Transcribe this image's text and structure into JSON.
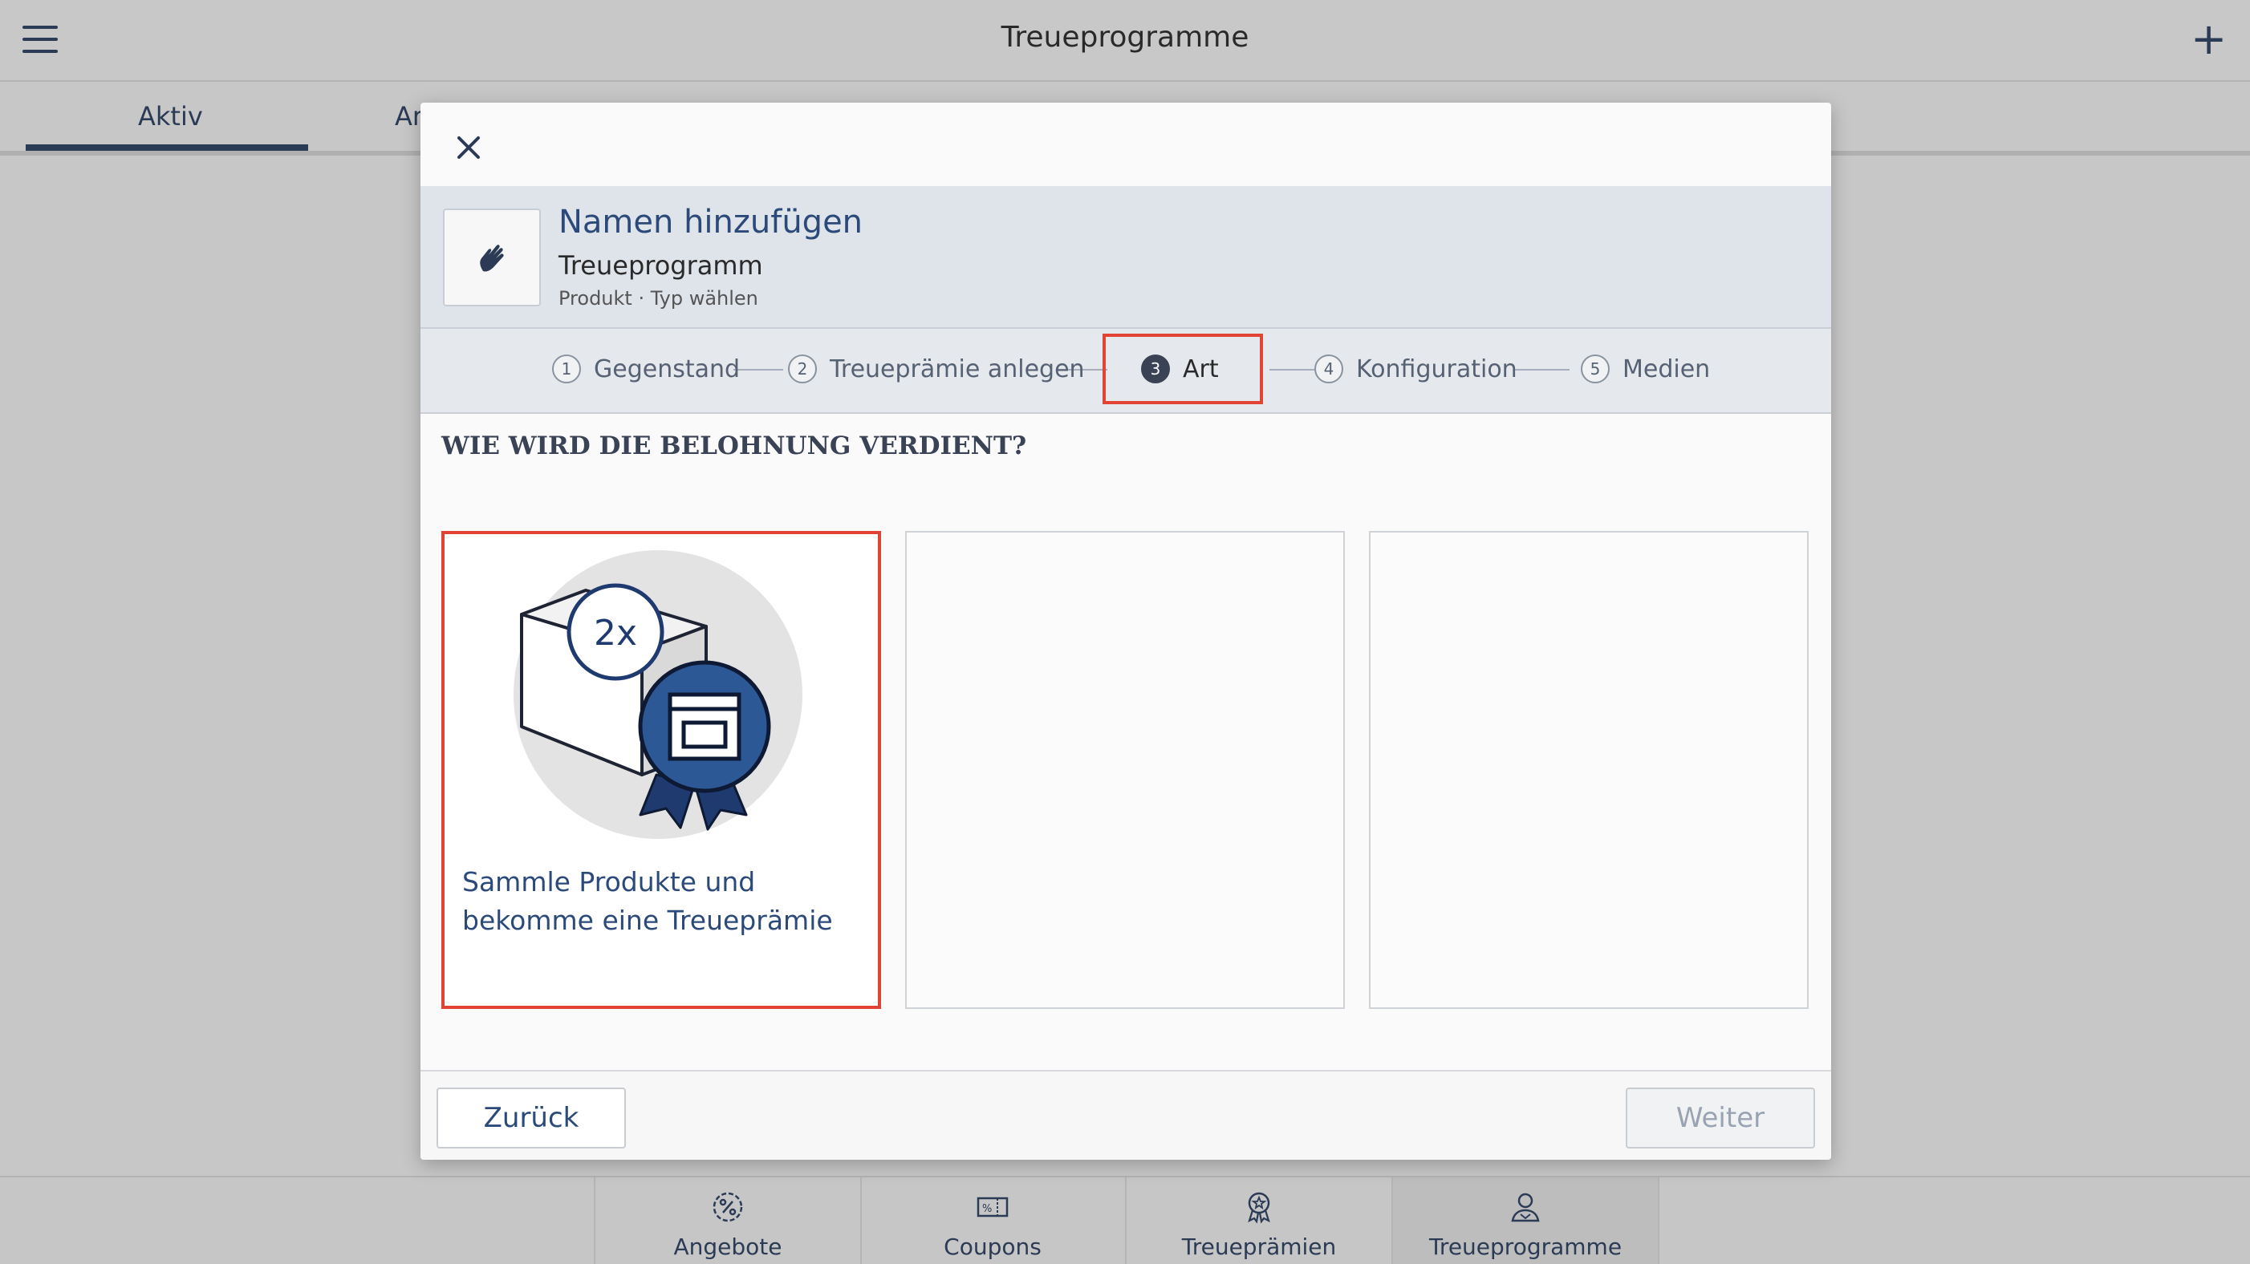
{
  "app": {
    "title": "Treueprogramme"
  },
  "tabs": [
    {
      "label": "Aktiv"
    },
    {
      "label": "Ar"
    }
  ],
  "modal": {
    "header": {
      "title": "Namen hinzufügen",
      "subtitle": "Treueprogramm",
      "meta": "Produkt · Typ wählen",
      "thumb_icon": "hand-icon"
    },
    "steps": [
      {
        "num": "1",
        "label": "Gegenstand",
        "active": false
      },
      {
        "num": "2",
        "label": "Treueprämie anlegen",
        "active": false
      },
      {
        "num": "3",
        "label": "Art",
        "active": true
      },
      {
        "num": "4",
        "label": "Konfiguration",
        "active": false
      },
      {
        "num": "5",
        "label": "Medien",
        "active": false
      }
    ],
    "question": "WIE WIRD DIE BELOHNUNG VERDIENT?",
    "options": [
      {
        "label": "Sammle Produkte und bekomme eine Treueprämie",
        "badge": "2x",
        "selected": true
      },
      {
        "label": "",
        "selected": false
      },
      {
        "label": "",
        "selected": false
      }
    ],
    "footer": {
      "back_label": "Zurück",
      "next_label": "Weiter"
    }
  },
  "bottom_nav": [
    {
      "label": "Angebote",
      "icon": "percent-badge-icon",
      "selected": false
    },
    {
      "label": "Coupons",
      "icon": "coupon-icon",
      "selected": false
    },
    {
      "label": "Treueprämien",
      "icon": "award-icon",
      "selected": false
    },
    {
      "label": "Treueprogramme",
      "icon": "loyalty-person-icon",
      "selected": true
    }
  ],
  "colors": {
    "accent": "#2b4a7a",
    "highlight": "#e14432",
    "overlay": "#c7c7c7"
  }
}
